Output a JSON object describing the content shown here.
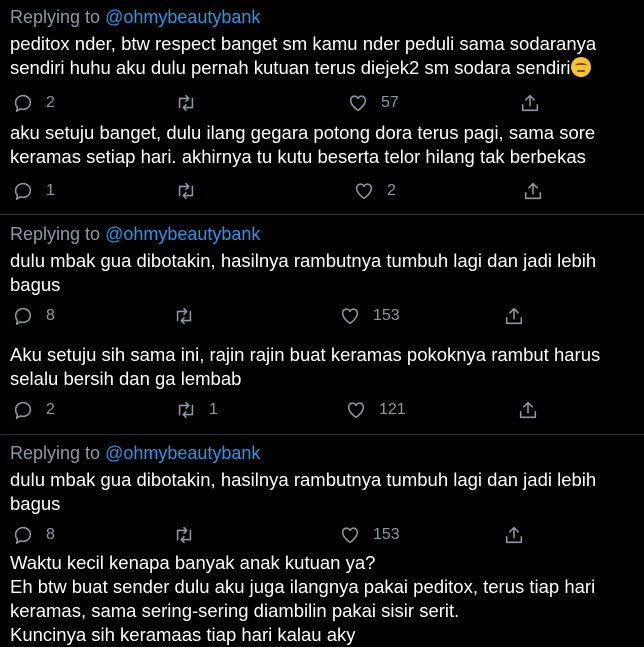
{
  "tweets": [
    {
      "replying_prefix": "Replying to ",
      "replying_handle": "@ohmybeautybank",
      "lines": [
        "peditox nder, btw respect banget sm kamu nder peduli sama sodaranya",
        "sendiri huhu aku dulu pernah kutuan terus diejek2 sm sodara sendiri"
      ],
      "emoji": "pensive-face",
      "replies": "2",
      "retweets": "",
      "likes": "57"
    },
    {
      "lines": [
        "aku setuju banget, dulu ilang gegara potong dora terus pagi, sama sore",
        "keramas setiap hari. akhirnya tu kutu beserta telor hilang tak berbekas"
      ],
      "replies": "1",
      "retweets": "",
      "likes": "2"
    },
    {
      "replying_prefix": "Replying to ",
      "replying_handle": "@ohmybeautybank",
      "lines": [
        "dulu mbak gua dibotakin, hasilnya rambutnya tumbuh lagi dan jadi lebih",
        "bagus"
      ],
      "replies": "8",
      "retweets": "",
      "likes": "153"
    },
    {
      "lines": [
        "Aku setuju sih sama ini, rajin rajin buat keramas pokoknya rambut harus",
        "selalu bersih dan ga lembab"
      ],
      "replies": "2",
      "retweets": "1",
      "likes": "121"
    },
    {
      "replying_prefix": "Replying to ",
      "replying_handle": "@ohmybeautybank",
      "lines": [
        "dulu mbak gua dibotakin, hasilnya rambutnya tumbuh lagi dan jadi lebih",
        "bagus"
      ],
      "replies": "8",
      "retweets": "",
      "likes": "153"
    },
    {
      "lines": [
        "Waktu kecil kenapa banyak anak kutuan ya?",
        "Eh btw buat sender dulu aku juga ilangnya pakai peditox, terus tiap hari",
        "keramas, sama sering-sering diambilin pakai sisir serit.",
        "Kuncinya sih keramaas tiap hari kalau aky"
      ]
    }
  ],
  "icons": {
    "reply": "reply-bubble-icon",
    "retweet": "retweet-arrows-icon",
    "like": "heart-icon",
    "share": "share-upload-icon"
  },
  "colors": {
    "background": "#000000",
    "text": "#ffffff",
    "muted": "#8b98a5",
    "link": "#1d9bf0"
  }
}
